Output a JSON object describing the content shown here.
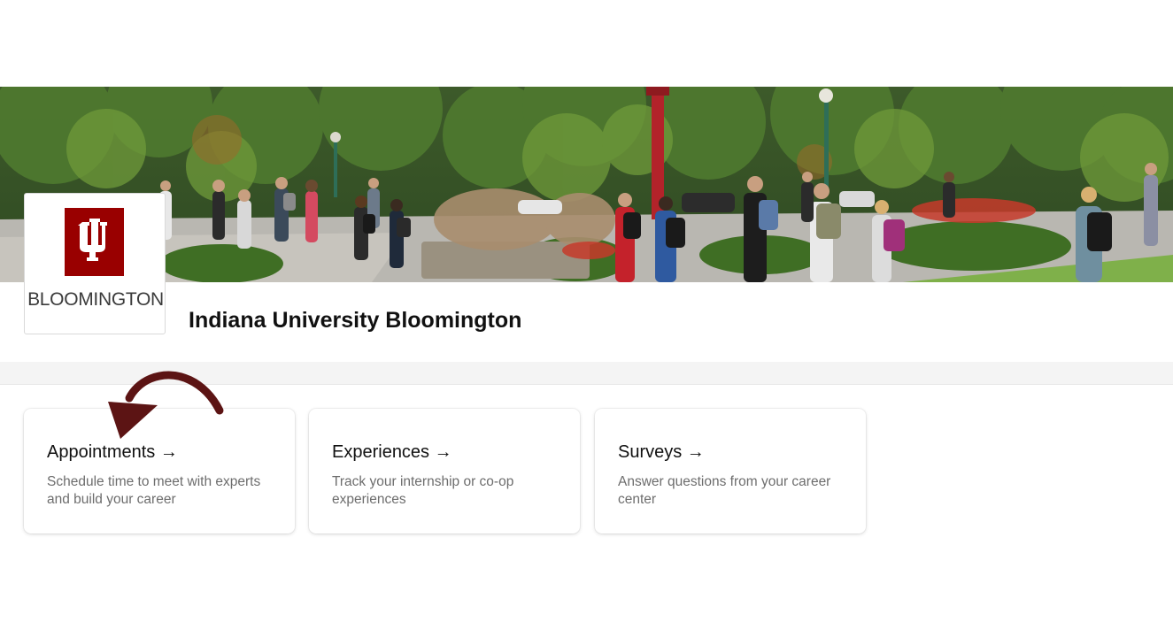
{
  "school": {
    "logo_text": "BLOOMINGTON",
    "logo_icon": "iu-trident-icon",
    "name": "Indiana University Bloomington",
    "brand_color": "#990000"
  },
  "banner": {
    "image": "campus-photo-students-walking"
  },
  "cards": [
    {
      "title": "Appointments →",
      "description": "Schedule time to meet with experts and build your career"
    },
    {
      "title": "Experiences →",
      "description": "Track your internship or co-op experiences"
    },
    {
      "title": "Surveys →",
      "description": "Answer questions from your career center"
    }
  ],
  "annotation": {
    "icon": "curved-arrow-icon",
    "color": "#5c1414"
  }
}
